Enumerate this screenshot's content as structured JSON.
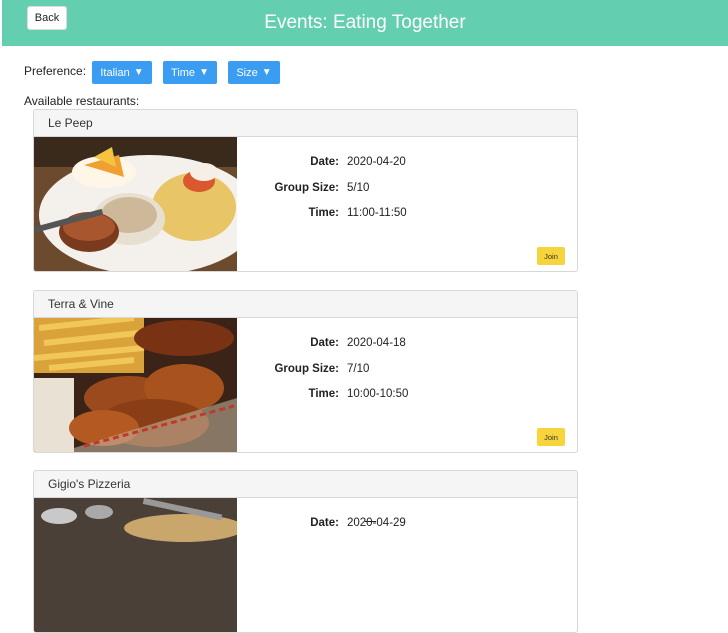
{
  "header": {
    "back_label": "Back",
    "title": "Events: Eating Together"
  },
  "preferences": {
    "label": "Preference:",
    "filters": [
      {
        "label": "Italian",
        "caret": "▼"
      },
      {
        "label": "Time",
        "caret": "▼"
      },
      {
        "label": "Size",
        "caret": "▼"
      }
    ]
  },
  "available_label": "Available restaurants:",
  "labels": {
    "date": "Date:",
    "group_size": "Group Size:",
    "time": "Time:",
    "join": "Join"
  },
  "restaurants": [
    {
      "name": "Le Peep",
      "date": "2020-04-20",
      "group_size": "5/10",
      "time": "11:00-11:50"
    },
    {
      "name": "Terra & Vine",
      "date": "2020-04-18",
      "group_size": "7/10",
      "time": "10:00-10:50"
    },
    {
      "name": "Gigio's Pizzeria",
      "date": "2020-04-29",
      "group_size": "",
      "time": ""
    }
  ],
  "colors": {
    "header": "#64cfb0",
    "filter_button": "#3a9df1",
    "join_button": "#f7d43c"
  }
}
